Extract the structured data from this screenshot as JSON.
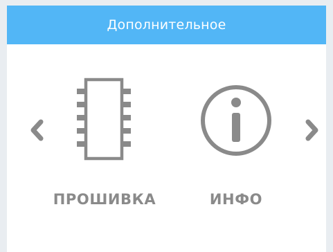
{
  "header": {
    "title": "Дополнительное"
  },
  "menu": {
    "items": [
      {
        "label": "ПРОШИВКА",
        "icon": "chip-icon"
      },
      {
        "label": "ИНФО",
        "icon": "info-icon"
      }
    ]
  },
  "navigation": {
    "prev_icon": "chevron-left-icon",
    "next_icon": "chevron-right-icon"
  },
  "colors": {
    "header": "#52b6f6",
    "icon": "#8a8a8a",
    "label": "#8a8a8a",
    "background": "#ffffff"
  }
}
